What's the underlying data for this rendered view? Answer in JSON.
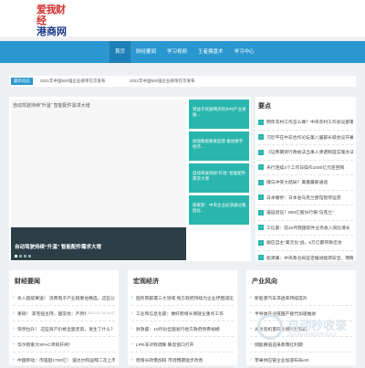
{
  "header": {
    "logo_top": "爱我财经",
    "logo_bottom": "港商网"
  },
  "nav": {
    "items": [
      "首页",
      "财经要闻",
      "学习视频",
      "王者摸盘术",
      "学习中心"
    ]
  },
  "ticker": {
    "label": "最新动态",
    "items": [
      "2021年中国500强企业榜单在京发布",
      "2021年中国500强企业榜单在京发布"
    ]
  },
  "hero": {
    "alt": "自动驾驶持续“升温” 智能配件需求大增",
    "caption": "自动驾驶持续“升温” 智能配件需求大增"
  },
  "thumbs": [
    "受益于优质网点的乡村产业发展...",
    "加强数据要素监管 推动数字经济...",
    "自动驾驶持续“升温” 智能配件需求大增",
    "链家新：中央企业必须通过集团化..."
  ],
  "hot": {
    "title": "要点",
    "items": [
      "明年农村工作怎么做？中央农村工作会议部署",
      "习近平在中非合作论坛第八届部长级会议开幕式",
      "《证券期货行政执法当事人承诺制度实施办法》",
      "央行连续4个工作日操作1000亿元逆回购",
      "俄乌冲突大结局？美俄最新通话",
      "日本撤侨：日本驻乌克兰使馆暂停运营",
      "逼迫退伍！800亿股份行报“乌克兰”",
      "工信部：前10月我国软件业务收入同比增长",
      "顺应自主“美元化”战，5万亿都存款还会",
      "能源属：中央政治局坚定推进能源安全、明确能源"
    ]
  },
  "columns": [
    {
      "title": "财经要闻",
      "items": [
        {
          "text": "杀入超级赛道！ 消费电子产业链重估精选，这些公司",
          "date": ""
        },
        {
          "text": "重磅！ 李克强主持，国常会：严厉打击资本无序扩张",
          "date": "2022-07-15 20:47"
        },
        {
          "text": "突然拉升！ 这些资产价格全面走高，发生了什么？",
          "date": ""
        },
        {
          "text": "华尔街重大SPAC项目开闸！",
          "date": ""
        },
        {
          "text": "中国移动：市值超1700亿！ 道达尔和迪拜二次上市",
          "date": ""
        }
      ]
    },
    {
      "title": "宏观经济",
      "items": [
        {
          "text": "国务院部署三大领域 地方政府持续为企业纾困减压",
          "date": ""
        },
        {
          "text": "工业和信息化部：做好稳增长保就业重点工作",
          "date": ""
        },
        {
          "text": "财政部：10月份全国发行地方政府债券规模",
          "date": ""
        },
        {
          "text": "LPR非对称调降 降息窗口打开",
          "date": ""
        },
        {
          "text": "稳增长政策加码 市场预期逐步改善",
          "date": ""
        }
      ]
    },
    {
      "title": "产业风向",
      "items": [
        {
          "text": "新能源汽车渗透率持续提升",
          "date": ""
        },
        {
          "text": "半导体产业链国产替代加速推进",
          "date": ""
        },
        {
          "text": "光伏装机量同比增长超预期",
          "date": ""
        },
        {
          "text": "储能赛道迎来政策红利期",
          "date": ""
        },
        {
          "text": "苹果供应链企业加速布局AR",
          "date": ""
        }
      ]
    }
  ],
  "watermark": {
    "text": "自动秒收录",
    "sub": "ZIDONGMIAOSHOULU"
  },
  "colors": {
    "nav": "#2a97d0",
    "accent": "#29b6ac",
    "hero_bar": "#2c3e46"
  }
}
